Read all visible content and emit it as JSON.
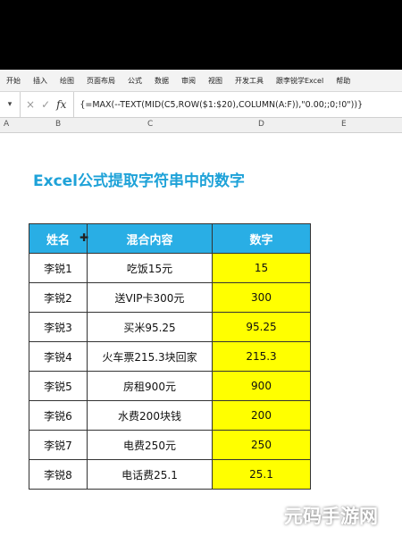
{
  "ribbon": {
    "tabs": [
      "开始",
      "插入",
      "绘图",
      "页面布局",
      "公式",
      "数据",
      "审阅",
      "视图",
      "开发工具",
      "跟李锐学Excel",
      "帮助"
    ]
  },
  "formula_bar": {
    "name_box": "",
    "cancel_icon": "×",
    "confirm_icon": "✓",
    "fx_label": "fx",
    "formula": "{=MAX(--TEXT(MID(C5,ROW($1:$20),COLUMN(A:F)),\"0.00;;0;!0\"))}"
  },
  "columns": [
    "A",
    "B",
    "C",
    "D",
    "E"
  ],
  "title": "Excel公式提取字符串中的数字",
  "table": {
    "headers": [
      "姓名",
      "混合内容",
      "数字"
    ],
    "rows": [
      [
        "李锐1",
        "吃饭15元",
        "15"
      ],
      [
        "李锐2",
        "送VIP卡300元",
        "300"
      ],
      [
        "李锐3",
        "买米95.25",
        "95.25"
      ],
      [
        "李锐4",
        "火车票215.3块回家",
        "215.3"
      ],
      [
        "李锐5",
        "房租900元",
        "900"
      ],
      [
        "李锐6",
        "水费200块钱",
        "200"
      ],
      [
        "李锐7",
        "电费250元",
        "250"
      ],
      [
        "李锐8",
        "电话费25.1",
        "25.1"
      ]
    ]
  },
  "watermark": "元码手游网",
  "colors": {
    "header_bg": "#29aee5",
    "result_bg": "#ffff00",
    "title": "#1ea2d8"
  }
}
